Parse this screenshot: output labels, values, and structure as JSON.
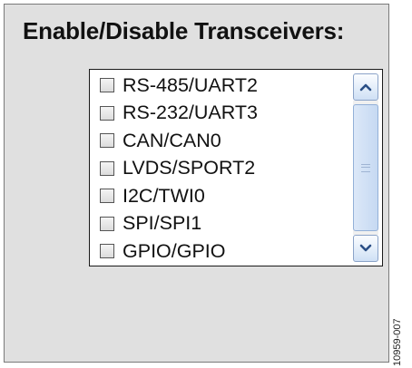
{
  "panel": {
    "title": "Enable/Disable Transceivers:"
  },
  "transceivers": [
    {
      "label": "RS-485/UART2",
      "checked": false
    },
    {
      "label": "RS-232/UART3",
      "checked": false
    },
    {
      "label": "CAN/CAN0",
      "checked": false
    },
    {
      "label": "LVDS/SPORT2",
      "checked": false
    },
    {
      "label": "I2C/TWI0",
      "checked": false
    },
    {
      "label": "SPI/SPI1",
      "checked": false
    },
    {
      "label": "GPIO/GPIO",
      "checked": false
    }
  ],
  "scrollbar": {
    "up_icon": "chevron-up-icon",
    "down_icon": "chevron-down-icon"
  },
  "figure_id": "10959-007",
  "colors": {
    "panel_bg": "#e0e0e0",
    "scrollbar_accent": "#c6d9f2",
    "arrow": "#2b4f86"
  }
}
